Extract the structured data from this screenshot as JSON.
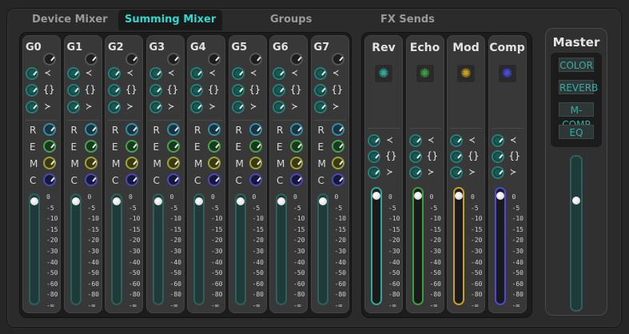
{
  "tabs": [
    {
      "label": "Device Mixer",
      "active": false
    },
    {
      "label": "Summing Mixer",
      "active": true
    },
    {
      "label": "Groups",
      "active": false
    },
    {
      "label": "FX Sends",
      "active": false
    }
  ],
  "groups": [
    {
      "name": "G0",
      "fader": 0.96
    },
    {
      "name": "G1",
      "fader": 0.96
    },
    {
      "name": "G2",
      "fader": 0.96
    },
    {
      "name": "G3",
      "fader": 0.96
    },
    {
      "name": "G4",
      "fader": 0.96
    },
    {
      "name": "G5",
      "fader": 0.96
    },
    {
      "name": "G6",
      "fader": 0.96
    },
    {
      "name": "G7",
      "fader": 0.96
    }
  ],
  "eq_glyphs": [
    "≺",
    "{}",
    "≻"
  ],
  "send_letters": [
    "R",
    "E",
    "M",
    "C"
  ],
  "fx": [
    {
      "name": "Rev",
      "color": "#2fa89a",
      "fader": 0.96
    },
    {
      "name": "Echo",
      "color": "#38a040",
      "fader": 0.96
    },
    {
      "name": "Mod",
      "color": "#c8a020",
      "fader": 0.96
    },
    {
      "name": "Comp",
      "color": "#4a4ad8",
      "fader": 0.96
    }
  ],
  "scale": [
    "0",
    "-5",
    "-10",
    "-15",
    "-20",
    "-30",
    "-40",
    "-50",
    "-60",
    "-80",
    "-∞"
  ],
  "master": {
    "title": "Master",
    "buttons": [
      "COLOR",
      "REVERB",
      "M-COMP",
      "EQ"
    ],
    "fader": 0.72
  },
  "colors": {
    "accent": "#2fd8d0",
    "strip": "#383838",
    "panel": "#1c1c1c"
  }
}
